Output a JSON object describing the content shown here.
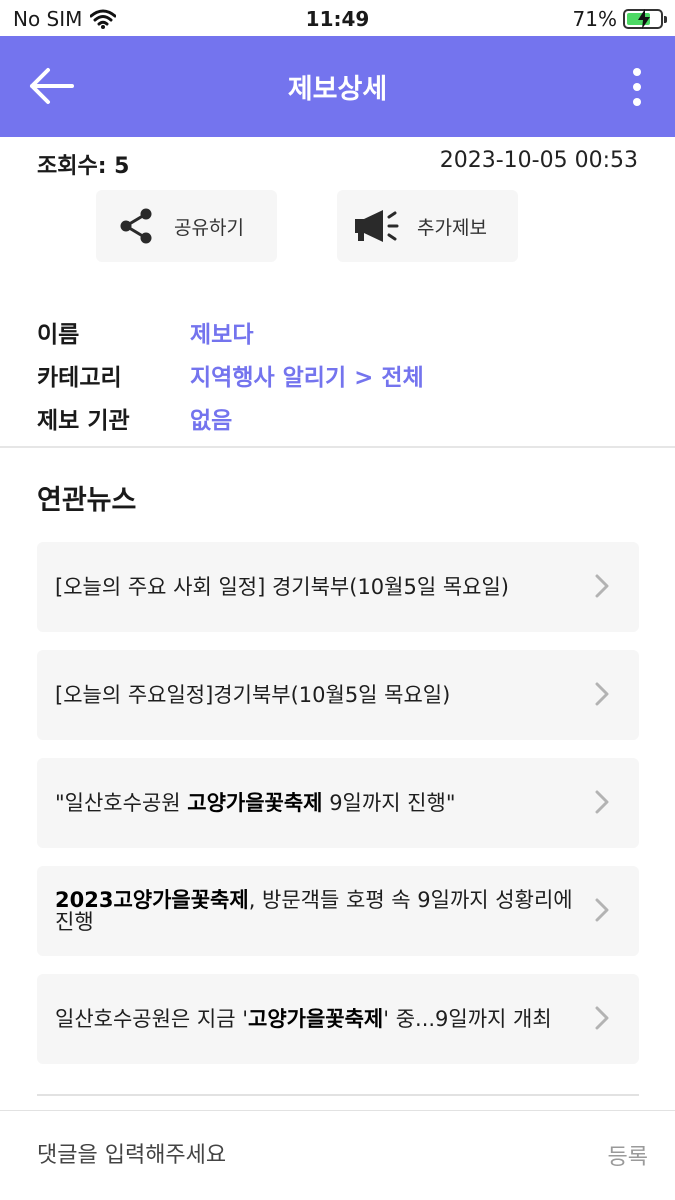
{
  "status_bar": {
    "carrier": "No SIM",
    "time": "11:49",
    "battery": "71%",
    "battery_level": 0.71,
    "icons": [
      "wifi-icon",
      "battery-charging-icon"
    ]
  },
  "header": {
    "title": "제보상세",
    "back_icon": "arrow-left-icon",
    "more_icon": "more-vertical-icon",
    "background": "#7474ee"
  },
  "meta": {
    "views": "조회수: 5",
    "datetime": "2023-10-05 00:53"
  },
  "actions": {
    "share_label": "공유하기",
    "share_icon": "share-icon",
    "report_label": "추가제보",
    "report_icon": "megaphone-icon"
  },
  "info": {
    "name_label": "이름",
    "name_value": "제보다",
    "category_label": "카테고리",
    "category_value": "지역행사 알리기 > 전체",
    "agency_label": "제보 기관",
    "agency_value": "없음",
    "accent": "#7474ee"
  },
  "related": {
    "title": "연관뉴스",
    "items": [
      {
        "pre": "[오늘의 주요 사회 일정] 경기북부(10월5일 목요일)",
        "bold": "",
        "post": ""
      },
      {
        "pre": "[오늘의 주요일정]경기북부(10월5일 목요일)",
        "bold": "",
        "post": ""
      },
      {
        "pre": "\"일산호수공원 ",
        "bold": "고양가을꽃축제",
        "post": " 9일까지 진행\""
      },
      {
        "pre": "",
        "bold": "2023고양가을꽃축제",
        "post": ", 방문객들 호평 속 9일까지 성황리에 진행"
      },
      {
        "pre": "일산호수공원은 지금 '",
        "bold": "고양가을꽃축제",
        "post": "' 중...9일까지 개최"
      }
    ]
  },
  "comment": {
    "placeholder": "댓글을 입력해주세요",
    "submit_label": "등록"
  }
}
